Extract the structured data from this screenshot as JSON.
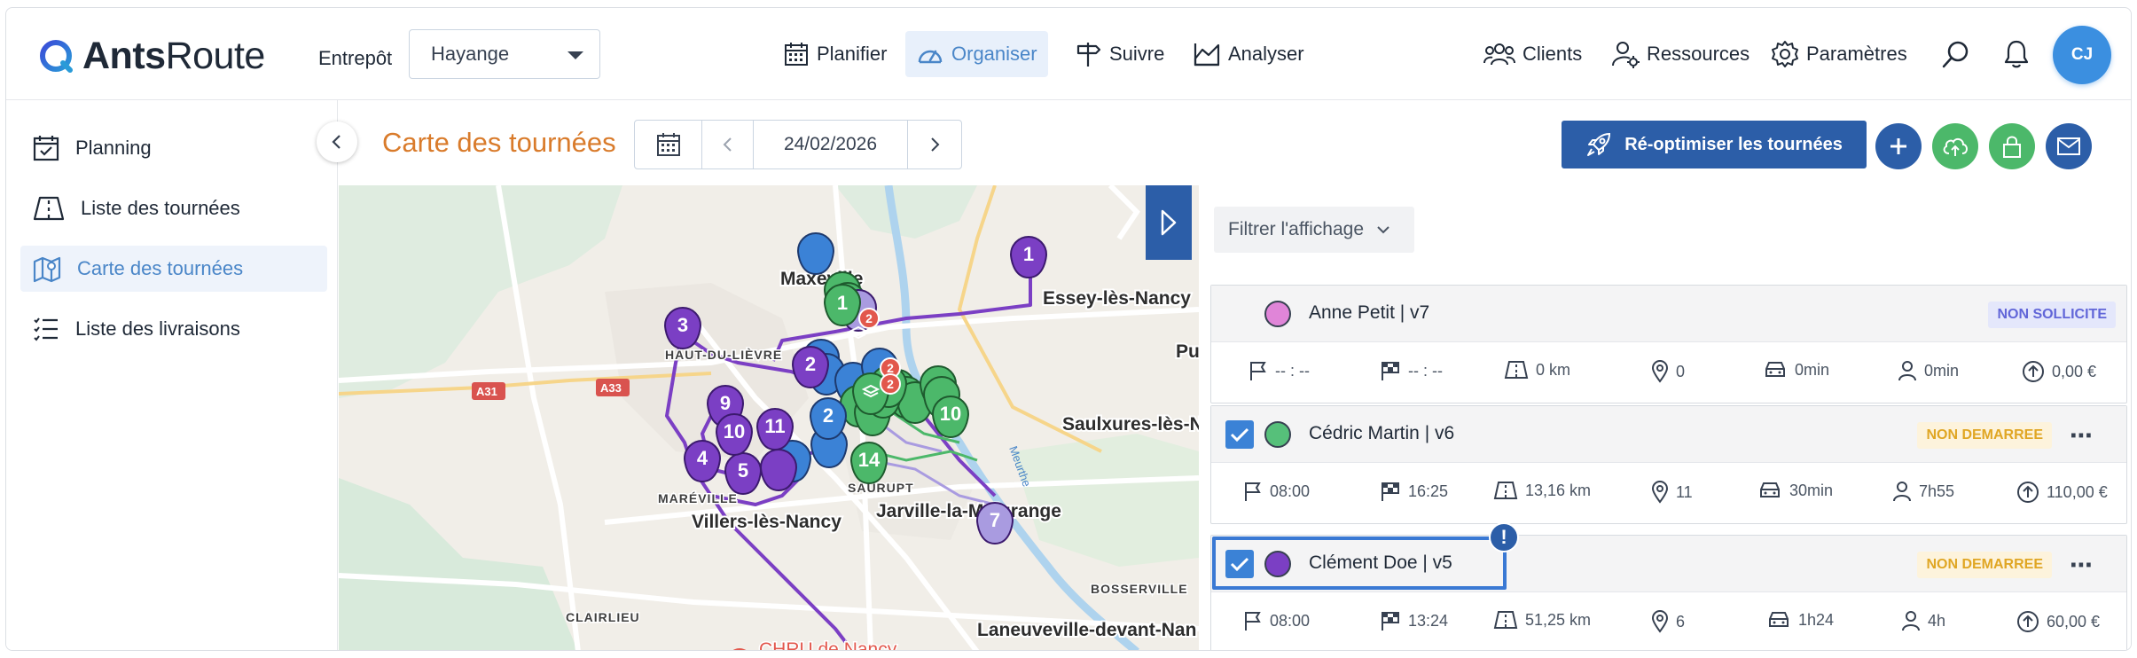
{
  "app": {
    "logo_bold": "Ants",
    "logo_light": "Route"
  },
  "header": {
    "entrepot_label": "Entrepôt",
    "entrepot_value": "Hayange",
    "nav": [
      {
        "label": "Planifier",
        "icon": "calendar-icon"
      },
      {
        "label": "Organiser",
        "icon": "gauge-icon",
        "active": true
      },
      {
        "label": "Suivre",
        "icon": "signpost-icon"
      },
      {
        "label": "Analyser",
        "icon": "chart-icon"
      }
    ],
    "right_nav": [
      {
        "label": "Clients",
        "icon": "users-icon"
      },
      {
        "label": "Ressources",
        "icon": "user-gear-icon"
      },
      {
        "label": "Paramètres",
        "icon": "gear-icon"
      }
    ],
    "avatar_initials": "CJ"
  },
  "sidebar": {
    "items": [
      {
        "label": "Planning",
        "icon": "calendar-check-icon"
      },
      {
        "label": "Liste des tournées",
        "icon": "road-icon"
      },
      {
        "label": "Carte des tournées",
        "icon": "map-icon",
        "active": true
      },
      {
        "label": "Liste des livraisons",
        "icon": "list-icon"
      }
    ]
  },
  "main": {
    "title": "Carte des tournées",
    "date": "24/02/2026",
    "reoptimize_label": "Ré-optimiser les tournées",
    "filter_label": "Filtrer l'affichage"
  },
  "map": {
    "labels": {
      "maxeville": "Maxéville",
      "essey": "Essey-lès-Nancy",
      "haut_du_lievre": "HAUT-DU-LIÈVRE",
      "pul": "Pul",
      "saulxures": "Saulxures-lès-N",
      "mareville": "MARÉVILLE",
      "saurupt": "SAURUPT",
      "villers": "Villers-lès-Nancy",
      "jarville": "Jarville-la-Malgrange",
      "bosserville": "BOSSERVILLE",
      "clairlieu": "CLAIRLIEU",
      "laneuveville": "Laneuveville-devant-Nan",
      "chru": "CHRU de Nancy",
      "meurthe": "Meurthe",
      "a31": "A31",
      "a33": "A33"
    },
    "markers": {
      "m1_purple": "1",
      "m1_green": "1",
      "m2_red": "2",
      "m2_purple": "2",
      "m2_blue": "2",
      "m3": "3",
      "m4": "4",
      "m5": "5",
      "m7": "7",
      "m9": "9",
      "m10_purple": "10",
      "m10_green": "10",
      "m11": "11",
      "m14": "14"
    },
    "colors": {
      "purple": "#7b3fc4",
      "light_purple": "#a99be0",
      "blue": "#3b82d6",
      "green": "#4cb86a",
      "red": "#e2574c"
    }
  },
  "vehicles": [
    {
      "name": "Anne Petit | v7",
      "color": "#e085d8",
      "checked": false,
      "status": "NON SOLLICITE",
      "start": "-- : --",
      "end": "-- : --",
      "distance": "0 km",
      "stops": "0",
      "drive": "0min",
      "work": "0min",
      "cost": "0,00 €"
    },
    {
      "name": "Cédric Martin | v6",
      "color": "#56c07a",
      "checked": true,
      "status": "NON DEMARREE",
      "start": "08:00",
      "end": "16:25",
      "distance": "13,16 km",
      "stops": "11",
      "drive": "30min",
      "work": "7h55",
      "cost": "110,00 €"
    },
    {
      "name": "Clément Doe | v5",
      "color": "#7b3fc4",
      "checked": true,
      "status": "NON DEMARREE",
      "start": "08:00",
      "end": "13:24",
      "distance": "51,25 km",
      "stops": "6",
      "drive": "1h24",
      "work": "4h",
      "cost": "60,00 €"
    }
  ],
  "warning_mark": "!"
}
